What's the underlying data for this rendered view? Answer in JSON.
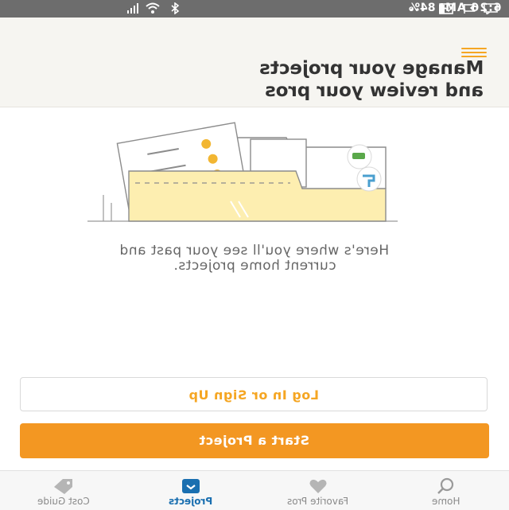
{
  "status_bar": {
    "time": "6:26 AM",
    "battery": "84%",
    "icons": [
      "battery-icon",
      "signal-icon",
      "wifi-icon",
      "bluetooth-icon",
      "more-icon",
      "gallery-icon",
      "flag-icon",
      "message-icon"
    ]
  },
  "header": {
    "title_line1": "Manage your projects",
    "title_line2": "and review your pros",
    "menu_icon": "menu-icon",
    "accent": "#f5a623"
  },
  "empty_state": {
    "illustration": "folder-illustration",
    "line1": "Here's where you'll see your past and",
    "line2": "current home projects."
  },
  "actions": {
    "login_label": "Log In or Sign Up",
    "start_label": "Start a Project",
    "primary_color": "#f39722"
  },
  "bottom_nav": {
    "items": [
      {
        "label": "Home",
        "icon": "search-icon"
      },
      {
        "label": "Favorite Pros",
        "icon": "heart-icon"
      },
      {
        "label": "Projects",
        "icon": "projects-icon",
        "active": true
      },
      {
        "label": "Cost Guide",
        "icon": "tag-icon"
      }
    ],
    "active_color": "#1a6fb0"
  }
}
